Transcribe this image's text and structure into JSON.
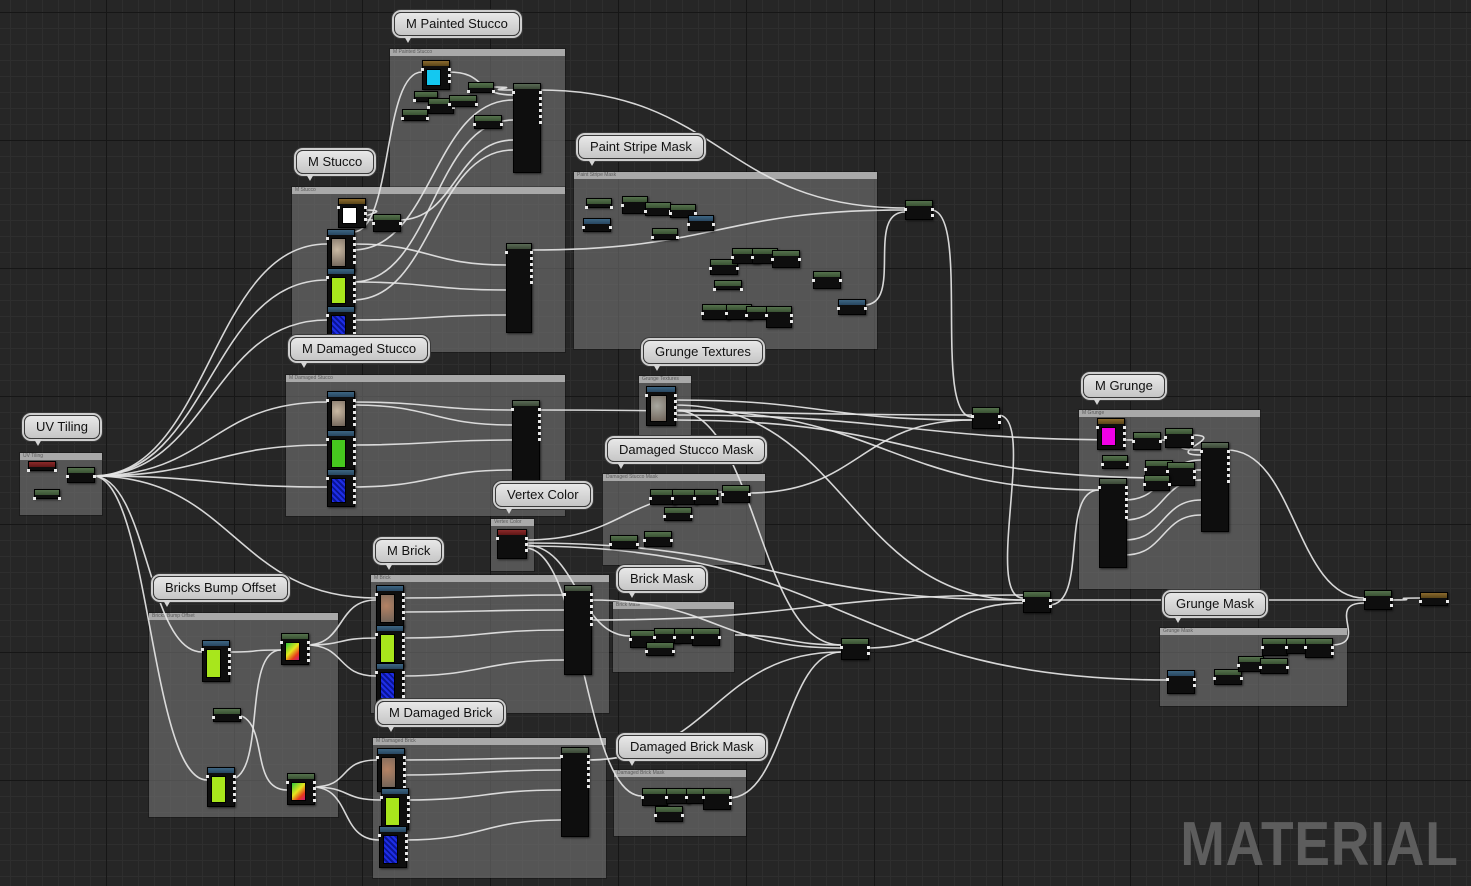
{
  "editor": {
    "watermark": "MATERIAL",
    "colors": {
      "canvas_background": "#262626",
      "comment_box": "#737373",
      "wire": "#e6e6e6",
      "node_header_generic": "#4b6644",
      "node_header_texture": "#35566f",
      "node_header_parameter": "#7a2222"
    }
  },
  "comments": [
    {
      "id": "uv-tiling",
      "label": "UV Tiling"
    },
    {
      "id": "m-painted-stucco",
      "label": "M Painted Stucco"
    },
    {
      "id": "m-stucco",
      "label": "M Stucco"
    },
    {
      "id": "paint-stripe-mask",
      "label": "Paint Stripe Mask"
    },
    {
      "id": "m-damaged-stucco",
      "label": "M Damaged Stucco"
    },
    {
      "id": "grunge-textures",
      "label": "Grunge Textures"
    },
    {
      "id": "damaged-stucco-mask",
      "label": "Damaged Stucco Mask"
    },
    {
      "id": "vertex-color",
      "label": "Vertex Color"
    },
    {
      "id": "m-brick",
      "label": "M Brick"
    },
    {
      "id": "bricks-bump-offset",
      "label": "Bricks Bump Offset"
    },
    {
      "id": "brick-mask",
      "label": "Brick Mask"
    },
    {
      "id": "m-damaged-brick",
      "label": "M Damaged Brick"
    },
    {
      "id": "damaged-brick-mask",
      "label": "Damaged Brick Mask"
    },
    {
      "id": "m-grunge",
      "label": "M Grunge"
    },
    {
      "id": "grunge-mask",
      "label": "Grunge Mask"
    }
  ],
  "swatches": {
    "cyan": "#14c8f0",
    "white": "#ffffff",
    "stucco": "#c9b9a3",
    "lime": "#a8e61c",
    "green": "#46c81e",
    "blue_noise": "#1e2ee6",
    "magenta": "#f000e6",
    "brick": "#b48264",
    "grunge": "#a8a8a0"
  }
}
